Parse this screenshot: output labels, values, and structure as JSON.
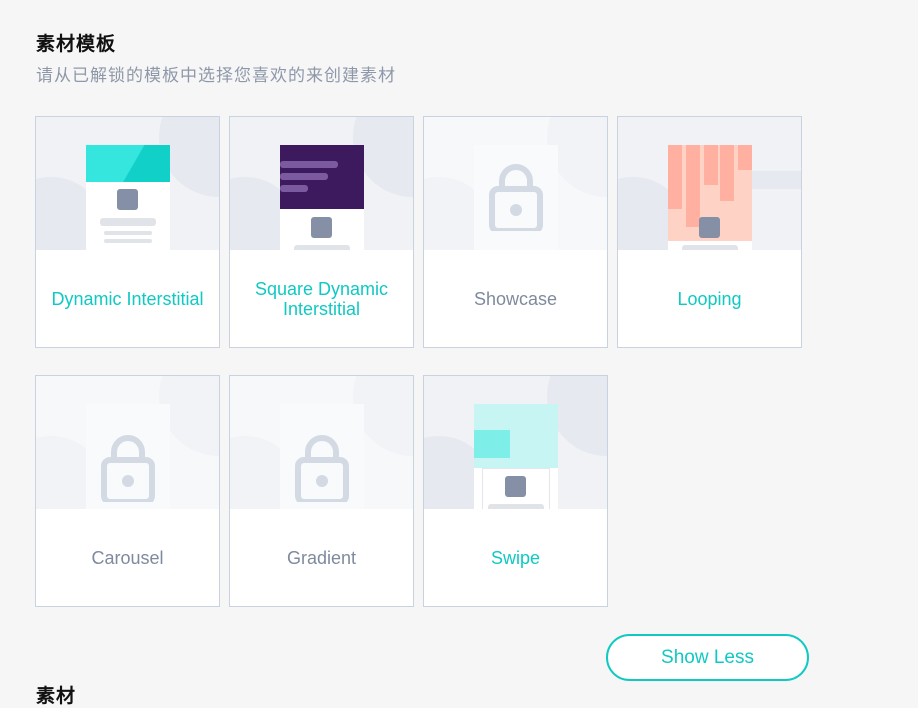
{
  "section": {
    "title": "素材模板",
    "subtitle": "请从已解锁的模板中选择您喜欢的来创建素材"
  },
  "templates": [
    {
      "label": "Dynamic Interstitial",
      "locked": false,
      "preview": "dynamic-interstitial"
    },
    {
      "label": "Square Dynamic Interstitial",
      "locked": false,
      "preview": "square-dynamic-interstitial"
    },
    {
      "label": "Showcase",
      "locked": true,
      "preview": "lock-icon"
    },
    {
      "label": "Looping",
      "locked": false,
      "preview": "looping"
    },
    {
      "label": "Carousel",
      "locked": true,
      "preview": "lock-icon"
    },
    {
      "label": "Gradient",
      "locked": true,
      "preview": "lock-icon"
    },
    {
      "label": "Swipe",
      "locked": false,
      "preview": "swipe"
    }
  ],
  "show_less_button": "Show Less",
  "next_section_title": "素材",
  "colors": {
    "accent": "#10c9c3",
    "disabled_text": "#7f8a9c",
    "card_border": "#c9d3e0",
    "dynamic_header": "#2ee0d8",
    "square_header": "#3d1a5e",
    "looping_bars": "#ffb3a3",
    "swipe_header": "#c6f5f4"
  }
}
